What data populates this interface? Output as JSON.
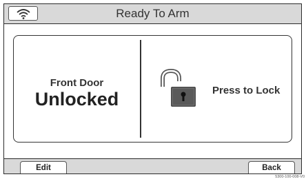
{
  "header": {
    "status_title": "Ready To Arm",
    "wifi_icon": "wifi-icon"
  },
  "door": {
    "name": "Front Door",
    "state": "Unlocked"
  },
  "lock_action": {
    "label": "Press to Lock",
    "icon": "unlocked-padlock-icon"
  },
  "footer": {
    "edit_label": "Edit",
    "back_label": "Back"
  },
  "figure_code": "5300-100-008-V0",
  "colors": {
    "bar_gray": "#d9d9d9",
    "border": "#2a2a2a",
    "background": "#ffffff"
  }
}
